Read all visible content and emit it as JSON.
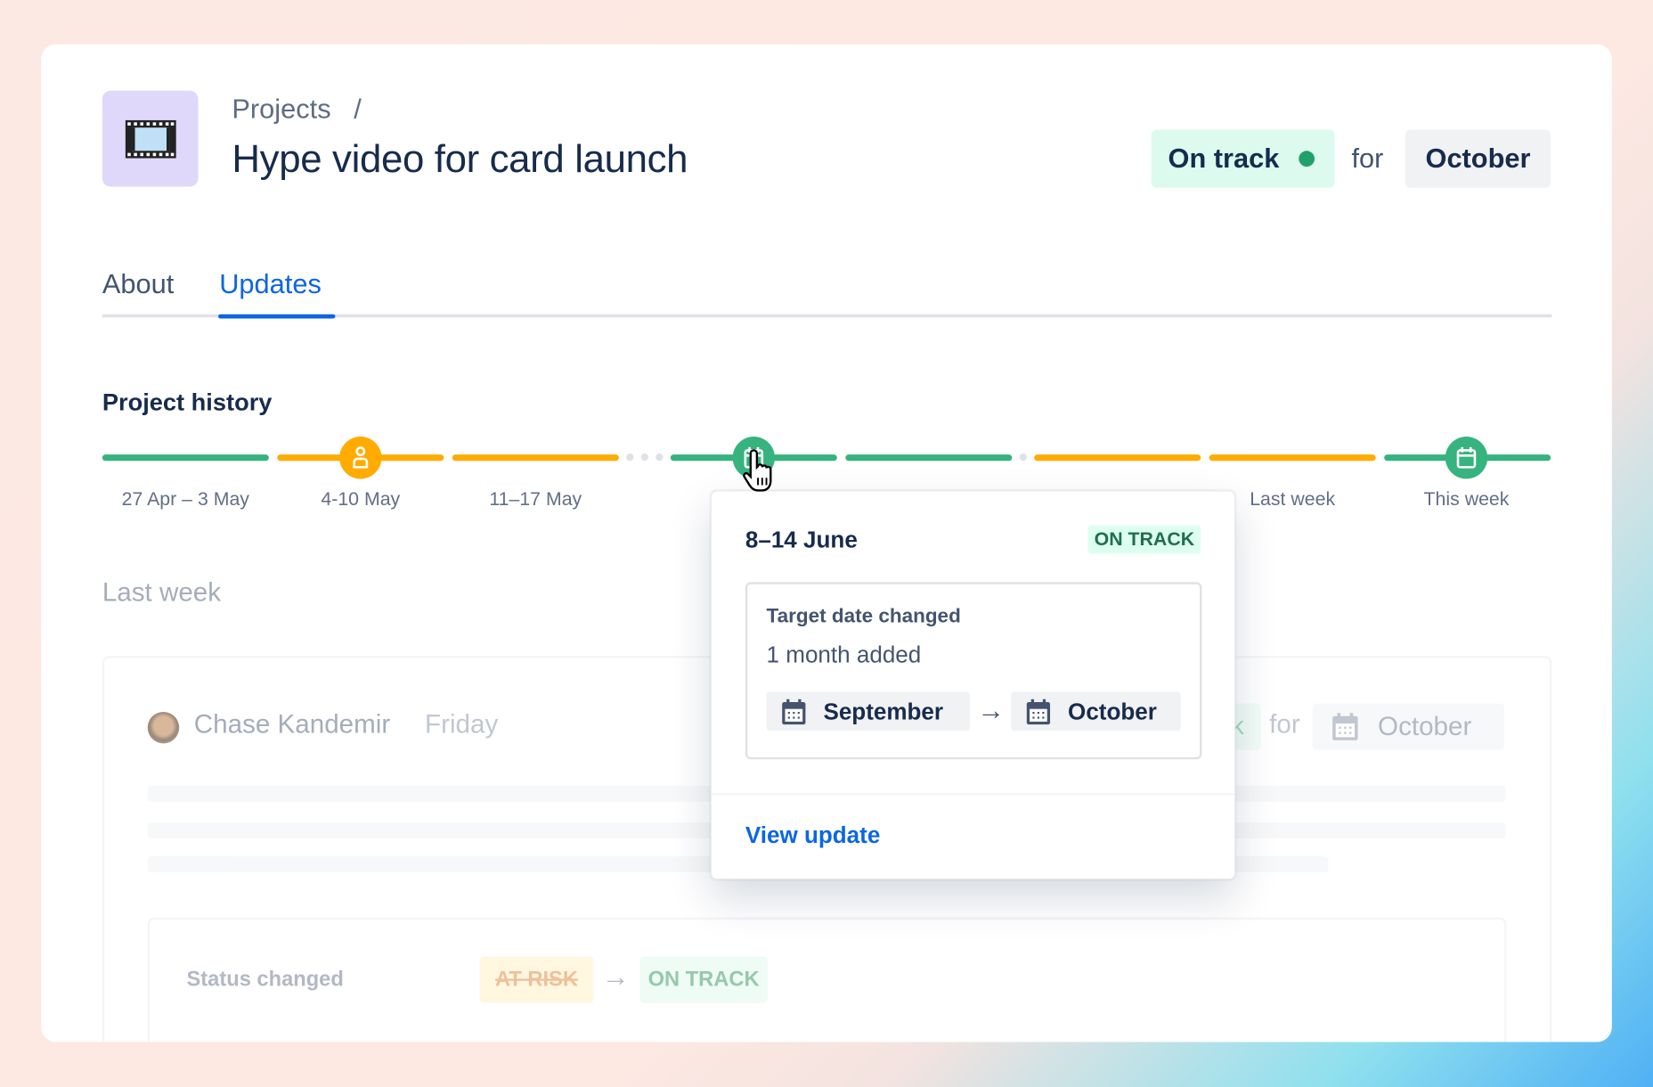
{
  "header": {
    "breadcrumb": "Projects",
    "breadcrumb_separator": "/",
    "title": "Hype video for card launch",
    "project_icon": "film-frames-icon",
    "status": {
      "label": "On track",
      "color": "#22a06b"
    },
    "for_label": "for",
    "target": "October"
  },
  "tabs": [
    {
      "label": "About",
      "active": false
    },
    {
      "label": "Updates",
      "active": true
    }
  ],
  "history": {
    "heading": "Project history",
    "segments": [
      {
        "status": "on-track"
      },
      {
        "status": "at-risk",
        "icon": "person-icon"
      },
      {
        "status": "at-risk"
      },
      {
        "status": "on-track",
        "icon": "calendar-icon"
      },
      {
        "status": "on-track"
      },
      {
        "status": "at-risk"
      },
      {
        "status": "at-risk"
      },
      {
        "status": "on-track",
        "icon": "calendar-icon"
      }
    ],
    "labels": [
      "27 Apr – 3 May",
      "4-10 May",
      "11–17 May",
      "Last week",
      "This week"
    ],
    "colors": {
      "on_track": "#36b37e",
      "at_risk": "#ffab00"
    }
  },
  "popup": {
    "date": "8–14 June",
    "badge": "ON TRACK",
    "change_title": "Target date changed",
    "change_detail": "1 month added",
    "from": "September",
    "to": "October",
    "link": "View update"
  },
  "feed": {
    "section": "Last week",
    "author": "Chase Kandemir",
    "day": "Friday",
    "status_tail": "k",
    "for_label": "for",
    "target": "October",
    "status_change": {
      "label": "Status changed",
      "from": "AT RISK",
      "to": "ON TRACK"
    }
  }
}
